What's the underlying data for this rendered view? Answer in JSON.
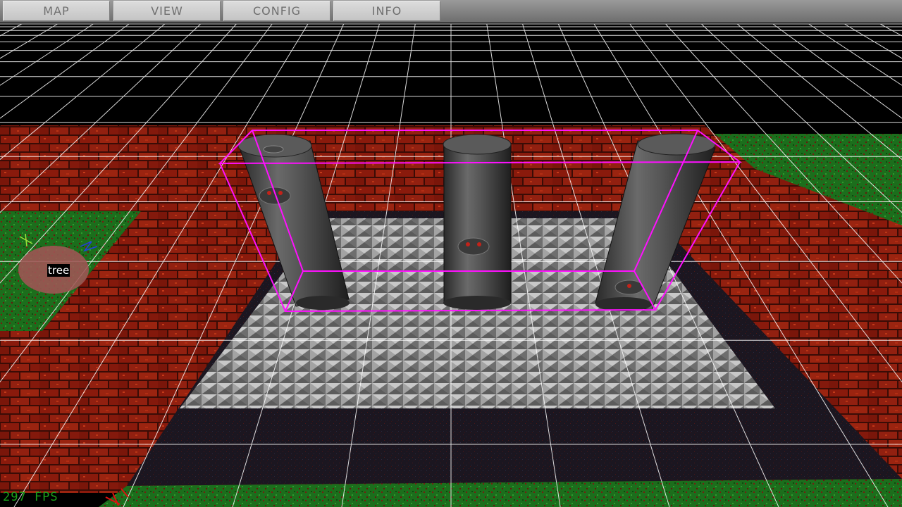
{
  "menu": {
    "items": [
      {
        "id": "map",
        "label": "MAP"
      },
      {
        "id": "view",
        "label": "VIEW"
      },
      {
        "id": "config",
        "label": "CONFIG"
      },
      {
        "id": "info",
        "label": "INFO"
      }
    ]
  },
  "viewport": {
    "thing_label": "tree",
    "fps_text": "297 FPS"
  },
  "colors": {
    "menubar": "#7d7d7d",
    "menu_button": "#cfcfcf",
    "menu_text": "#6f6f6f",
    "sky": "#000000",
    "grid": "#ffffff",
    "selection_box": "#ff10ff",
    "brick": "#8a1a0c",
    "mortar": "#3a0c06",
    "grass": "#1f7a1f",
    "floor_tile": "#8c8c8c",
    "dark_floor": "#1c1820",
    "pillar": "#4a4a4a",
    "fps": "#1aa31a"
  },
  "icons": {
    "selection": "selection-box-icon",
    "thing_marker": "thing-marker-icon",
    "axis_gizmo": "axis-gizmo-icon"
  }
}
